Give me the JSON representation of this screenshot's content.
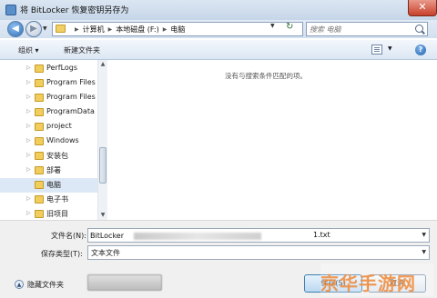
{
  "window": {
    "title": "将 BitLocker 恢复密钥另存为",
    "close_glyph": "✕"
  },
  "address": {
    "crumbs": [
      "计算机",
      "本地磁盘 (F:)",
      "电脑"
    ],
    "search_placeholder": "搜索 电脑"
  },
  "toolbar": {
    "organize_label": "组织 ▾",
    "new_folder_label": "新建文件夹",
    "help_glyph": "?"
  },
  "nav": {
    "items": [
      {
        "label": "PerfLogs",
        "selected": false
      },
      {
        "label": "Program Files",
        "selected": false
      },
      {
        "label": "Program Files",
        "selected": false
      },
      {
        "label": "ProgramData",
        "selected": false
      },
      {
        "label": "project",
        "selected": false
      },
      {
        "label": "Windows",
        "selected": false
      },
      {
        "label": "安装包",
        "selected": false
      },
      {
        "label": "部署",
        "selected": false
      },
      {
        "label": "电脑",
        "selected": true
      },
      {
        "label": "电子书",
        "selected": false
      },
      {
        "label": "旧项目",
        "selected": false
      }
    ]
  },
  "content": {
    "empty_message": "没有与搜索条件匹配的项。"
  },
  "form": {
    "filename_label": "文件名(N):",
    "filename_prefix": "BitLocker",
    "filename_suffix": "1.txt",
    "filetype_label": "保存类型(T):",
    "filetype_value": "文本文件"
  },
  "footer": {
    "hide_folders_label": "隐藏文件夹",
    "save_label": "保存(S)",
    "cancel_label": "取消"
  },
  "watermark": {
    "text": "京华手游网"
  }
}
